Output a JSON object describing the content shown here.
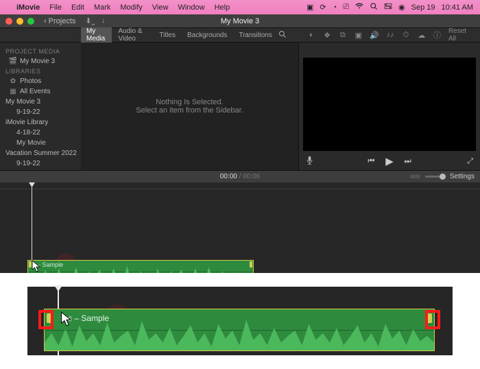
{
  "menubar": {
    "app": "iMovie",
    "items": [
      "File",
      "Edit",
      "Mark",
      "Modify",
      "View",
      "Window",
      "Help"
    ],
    "date": "Sep 19",
    "time": "10:41 AM"
  },
  "titlebar": {
    "back": "Projects",
    "title": "My Movie 3"
  },
  "tabs": {
    "items": [
      "My Media",
      "Audio & Video",
      "Titles",
      "Backgrounds",
      "Transitions"
    ],
    "active_index": 0,
    "reset": "Reset All"
  },
  "sidebar": {
    "heads": {
      "project": "PROJECT MEDIA",
      "libraries": "LIBRARIES"
    },
    "project_item": "My Movie 3",
    "lib_photos": "Photos",
    "lib_allevents": "All Events",
    "lib_movie3": "My Movie 3",
    "lib_movie3_date": "9-19-22",
    "lib_library": "iMovie Library",
    "lib_418": "4-18-22",
    "lib_mymovie": "My Movie",
    "lib_vacation": "Vacation Summer 2022",
    "lib_919": "9-19-22"
  },
  "browser": {
    "line1": "Nothing Is Selected.",
    "line2": "Select an item from the Sidebar."
  },
  "timeline_header": {
    "current": "00:00",
    "duration": "00:06",
    "settings": "Settings"
  },
  "clip": {
    "label": "s – Sample"
  },
  "zoom_clip": {
    "label": "s – Sample"
  }
}
